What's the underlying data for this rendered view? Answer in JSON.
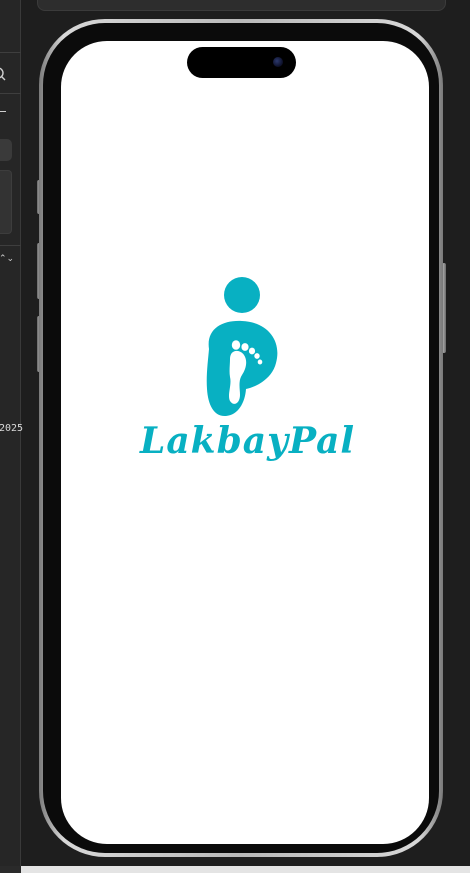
{
  "ide": {
    "sidebar": {
      "search_icon": "search-icon",
      "chevrons_glyph": "⌃⌄",
      "year_text": "2025"
    }
  },
  "simulator": {
    "device": "iPhone",
    "app": {
      "brand_name": "LakbayPal",
      "brand_color": "#08b0c2",
      "logo_icon": "footprint-person-icon"
    }
  }
}
